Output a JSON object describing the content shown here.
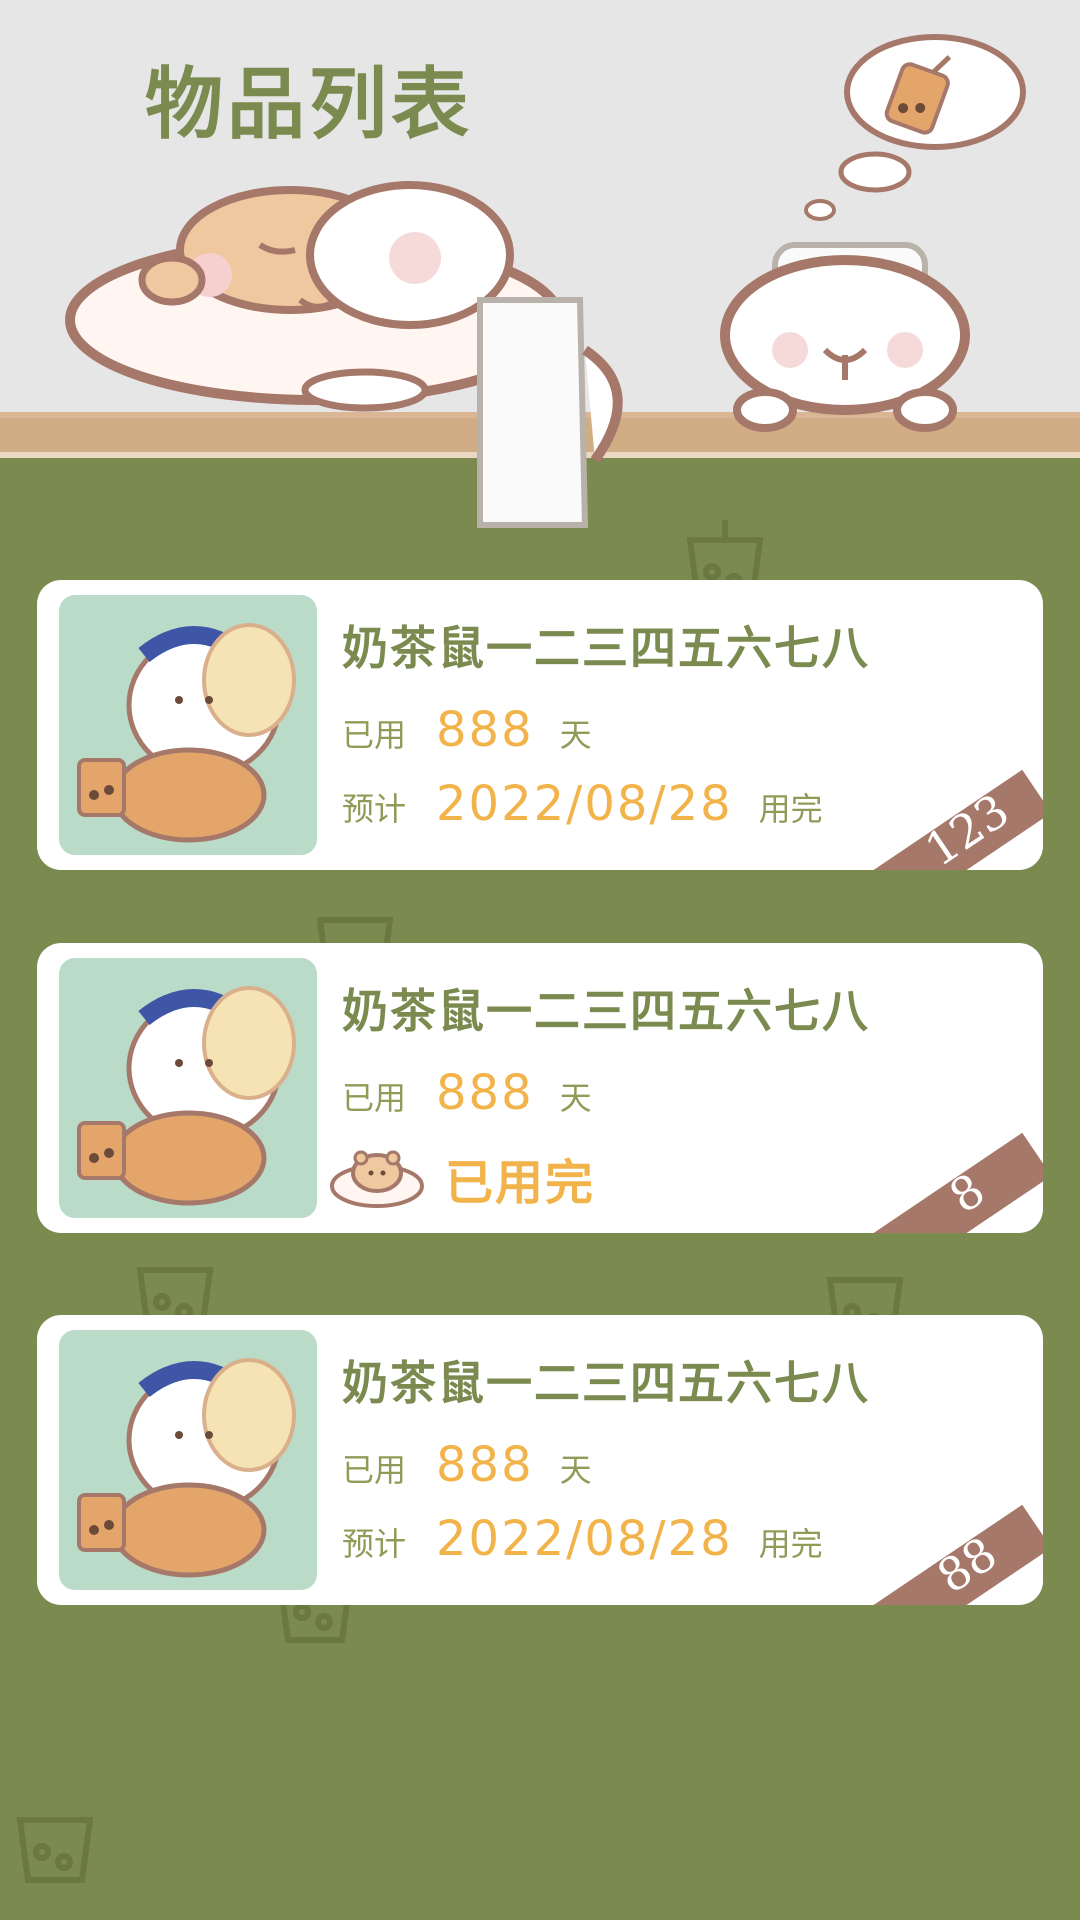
{
  "page": {
    "title": "物品列表"
  },
  "items": [
    {
      "name": "奶茶鼠一二三四五六七八",
      "used_label": "已用",
      "used_value": "888",
      "used_unit": "天",
      "plan_label": "预计",
      "plan_date": "2022/08/28",
      "plan_suffix": "用完",
      "badge": "123"
    },
    {
      "name": "奶茶鼠一二三四五六七八",
      "used_label": "已用",
      "used_value": "888",
      "used_unit": "天",
      "status_text": "已用完",
      "badge": "8"
    },
    {
      "name": "奶茶鼠一二三四五六七八",
      "used_label": "已用",
      "used_value": "888",
      "used_unit": "天",
      "plan_label": "预计",
      "plan_date": "2022/08/28",
      "plan_suffix": "用完",
      "badge": "88"
    }
  ],
  "colors": {
    "green": "#7b8a4f",
    "orange": "#f2b34a",
    "ribbon": "#a5786a",
    "thumb_bg": "#b9dbc8"
  },
  "icons": [
    "milk-tea-icon",
    "hamster-icon",
    "thought-bubble-icon"
  ]
}
